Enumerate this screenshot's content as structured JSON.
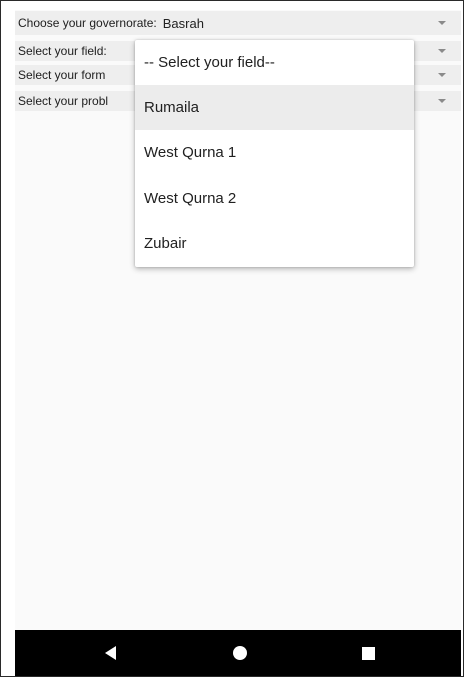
{
  "form": {
    "governorate": {
      "label": "Choose your governorate:",
      "value": "Basrah",
      "icon": "chevron-down-icon"
    },
    "field": {
      "label": "Select your field:",
      "icon": "chevron-down-icon"
    },
    "formation": {
      "label": "Select your form",
      "icon": "chevron-down-icon"
    },
    "problem": {
      "label": "Select your probl",
      "icon": "chevron-down-icon"
    }
  },
  "field_dropdown": {
    "options": [
      "-- Select your field--",
      "Rumaila",
      "West Qurna 1",
      "West Qurna 2",
      "Zubair"
    ],
    "highlighted_option": "Rumaila"
  },
  "navbar": {
    "buttons": [
      "back-icon",
      "home-icon",
      "recents-icon"
    ],
    "background": "#000000"
  },
  "colors": {
    "spinner_row_bg": "#eeeeee",
    "dropdown_bg": "#ffffff",
    "highlight_bg": "#ececec"
  }
}
